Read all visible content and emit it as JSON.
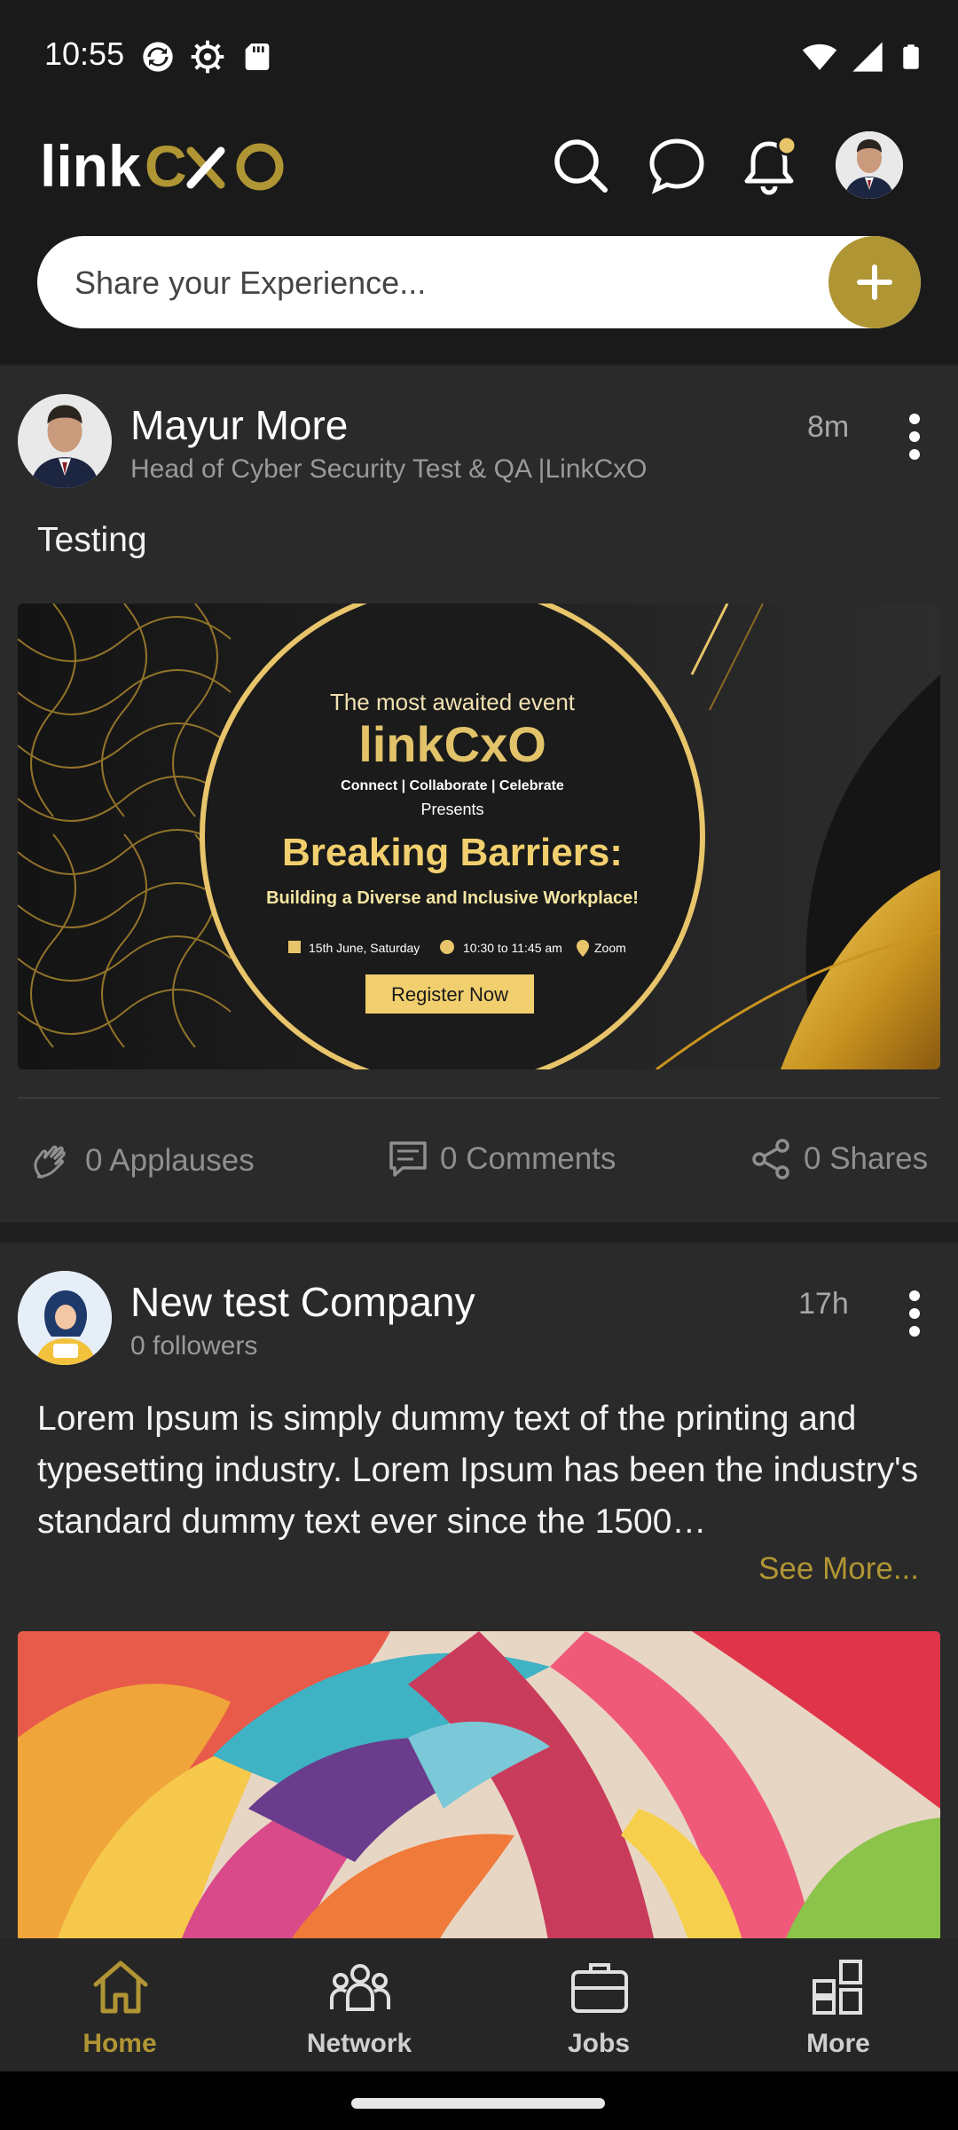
{
  "status_bar": {
    "time": "10:55",
    "left_icons": [
      "sync-icon",
      "settings-icon",
      "sd-card-icon"
    ],
    "right_icons": [
      "wifi-icon",
      "cellular-signal-icon",
      "battery-icon"
    ]
  },
  "header": {
    "logo_text": "linkCxO",
    "icons": [
      "search-icon",
      "chat-bubble-icon",
      "notification-bell-icon",
      "profile-avatar"
    ],
    "notification_dot_color": "#e8c46a",
    "share_placeholder": "Share your Experience...",
    "accent_color": "#b09534"
  },
  "posts": [
    {
      "author": "Mayur More",
      "subtitle": "Head of Cyber Security Test & QA |LinkCxO",
      "time": "8m",
      "text": "Testing",
      "image": {
        "kicker": "The most awaited event",
        "logo_text": "linkCxO",
        "tagline": "Connect | Collaborate | Celebrate",
        "presents": "Presents",
        "headline": "Breaking Barriers:",
        "subheadline": "Building a Diverse and Inclusive Workplace!",
        "date": "15th June, Saturday",
        "time": "10:30 to 11:45 am",
        "venue": "Zoom",
        "cta": "Register Now"
      },
      "applauses": "0 Applauses",
      "comments": "0 Comments",
      "shares": "0 Shares"
    },
    {
      "author": "New test Company",
      "subtitle": "0 followers",
      "time": "17h",
      "text": "Lorem Ipsum is simply dummy text of the printing and typesetting industry. Lorem Ipsum has been the industry's standard dummy text ever since the 1500…",
      "see_more": "See More..."
    }
  ],
  "bottom_nav": [
    {
      "label": "Home",
      "icon": "home-icon",
      "active": true
    },
    {
      "label": "Network",
      "icon": "network-icon",
      "active": false
    },
    {
      "label": "Jobs",
      "icon": "briefcase-icon",
      "active": false
    },
    {
      "label": "More",
      "icon": "grid-icon",
      "active": false
    }
  ]
}
